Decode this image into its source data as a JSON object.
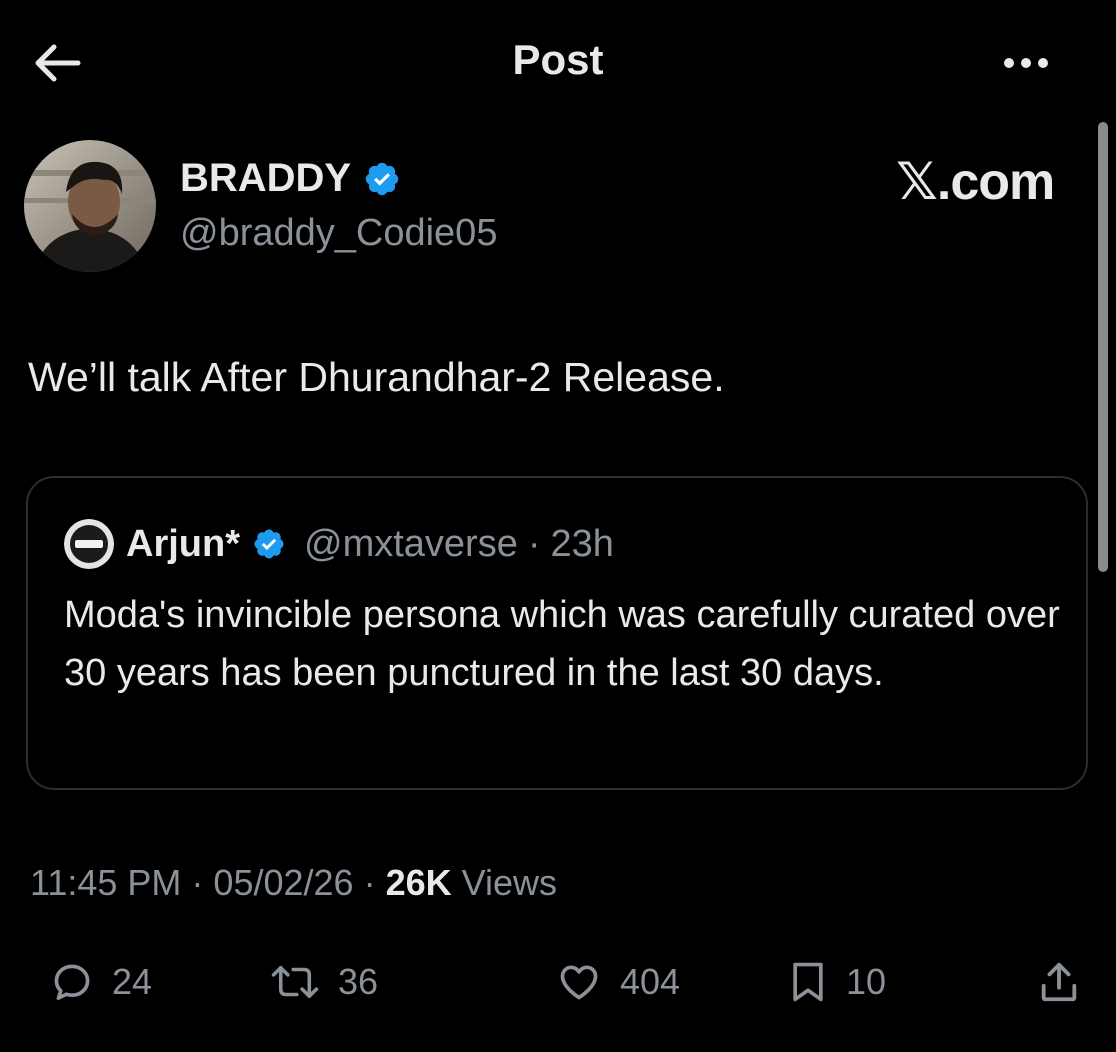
{
  "header": {
    "title": "Post"
  },
  "author": {
    "name": "BRADDY",
    "handle": "@braddy_Codie05",
    "verified": true
  },
  "brand": "𝕏.com",
  "tweet": {
    "text": "We’ll talk After Dhurandhar-2 Release."
  },
  "quote": {
    "name": "Arjun*",
    "handle": "@mxtaverse",
    "separator": "·",
    "time": "23h",
    "text": "Moda's invincible persona which was carefully curated over 30 years has been punctured in the last 30 days."
  },
  "meta": {
    "time": "11:45 PM",
    "separator": "·",
    "date": "05/02/26",
    "views_count": "26K",
    "views_label": "Views"
  },
  "actions": {
    "replies": "24",
    "reposts": "36",
    "likes": "404",
    "bookmarks": "10"
  },
  "colors": {
    "background": "#000000",
    "text": "#e7e9ea",
    "secondary": "#8b9199",
    "verified": "#1d9bf0",
    "border": "#2a2d31"
  },
  "icons": [
    "back-arrow-icon",
    "more-icon",
    "verified-badge-icon",
    "reply-icon",
    "repost-icon",
    "like-icon",
    "bookmark-icon",
    "share-icon"
  ]
}
